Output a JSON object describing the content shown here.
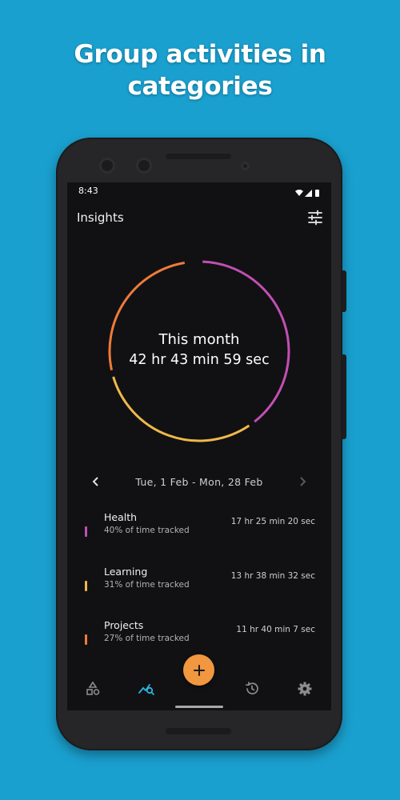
{
  "headline": {
    "line1": "Group activities in",
    "line2": "categories"
  },
  "status_bar": {
    "time": "8:43",
    "icons": [
      "wifi-icon",
      "cellular-icon",
      "battery-icon"
    ]
  },
  "app_bar": {
    "title": "Insights",
    "action_icon": "tune-icon"
  },
  "summary": {
    "label": "This month",
    "total": "42 hr 43 min 59 sec",
    "ring_segments": [
      {
        "category": "Health",
        "fraction": 0.4,
        "color": "#c24fb3"
      },
      {
        "category": "Learning",
        "fraction": 0.31,
        "color": "#f0b84a"
      },
      {
        "category": "Projects",
        "fraction": 0.27,
        "color": "#ee7b3a"
      }
    ]
  },
  "date_range": {
    "text": "Tue, 1 Feb - Mon, 28 Feb",
    "prev_icon": "chevron-left-icon",
    "next_icon": "chevron-right-icon"
  },
  "categories": [
    {
      "name": "Health",
      "percent_text": "40% of time tracked",
      "duration": "17 hr 25 min 20 sec",
      "color": "#c24fb3"
    },
    {
      "name": "Learning",
      "percent_text": "31% of time tracked",
      "duration": "13 hr 38 min 32 sec",
      "color": "#f0b84a"
    },
    {
      "name": "Projects",
      "percent_text": "27% of time tracked",
      "duration": "11 hr 40 min 7 sec",
      "color": "#ee7b3a"
    }
  ],
  "bottom_nav": {
    "items": [
      {
        "icon": "categories-icon",
        "active": false
      },
      {
        "icon": "insights-icon",
        "active": true
      },
      {
        "icon": "history-icon",
        "active": false
      },
      {
        "icon": "settings-icon",
        "active": false
      }
    ],
    "fab_icon": "plus-icon"
  },
  "colors": {
    "background": "#1aa0cf",
    "screen": "#111113",
    "accent": "#29b6e0",
    "fab": "#f0973f"
  }
}
